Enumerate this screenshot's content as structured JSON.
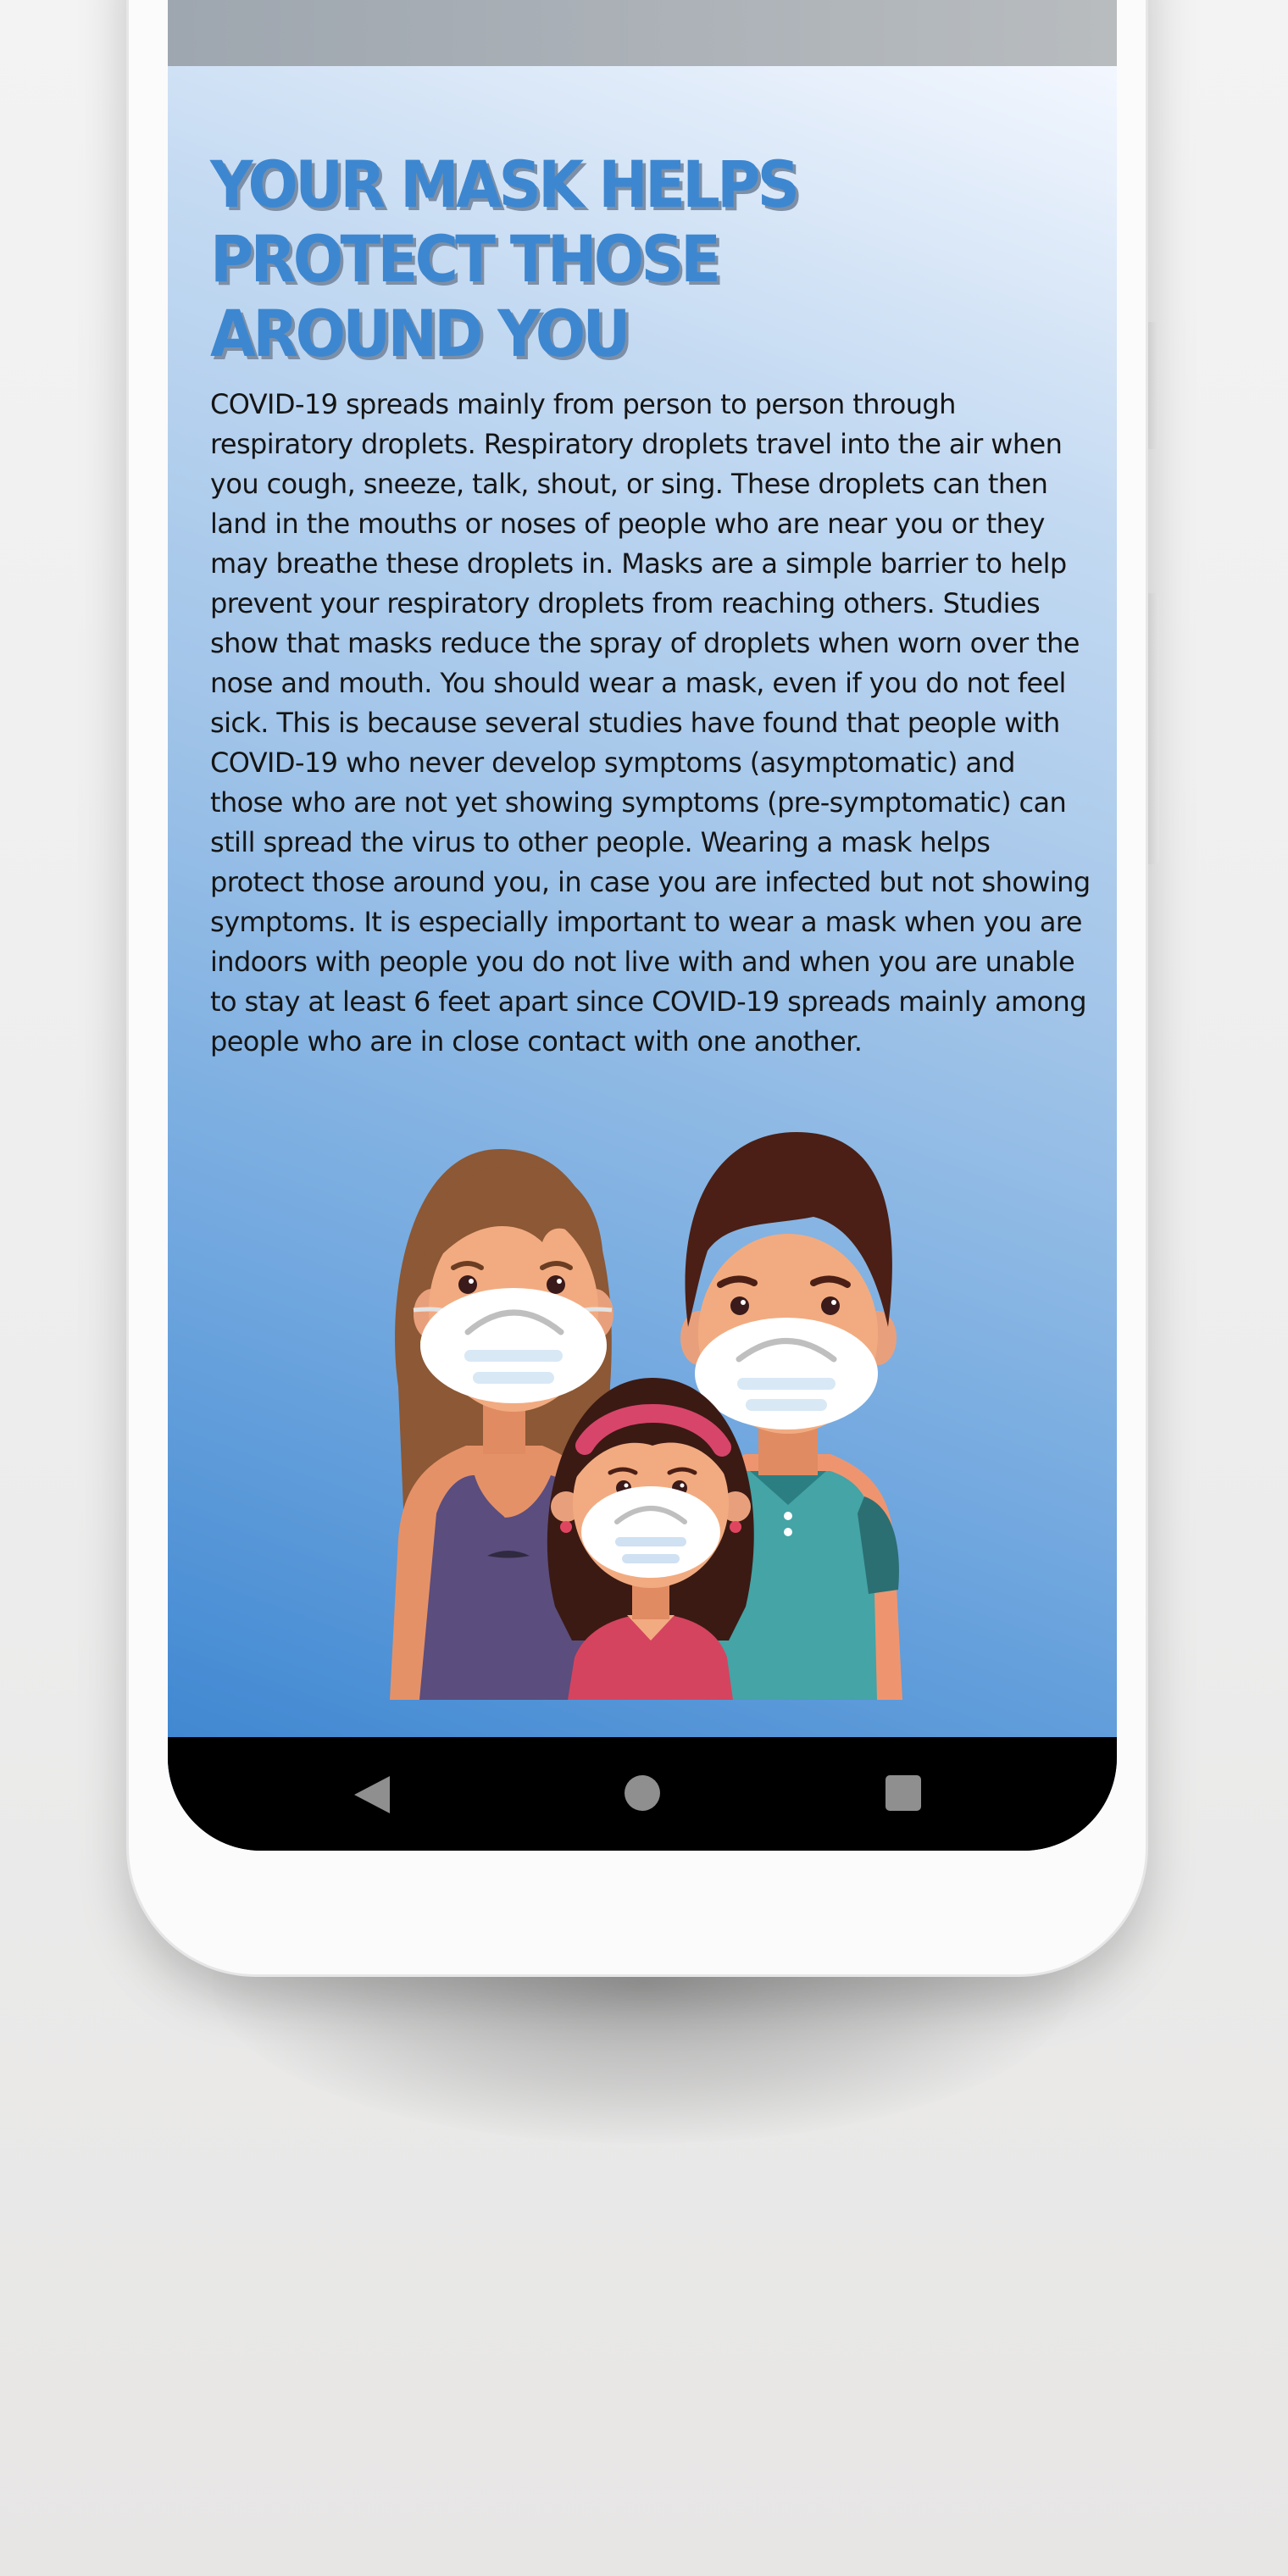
{
  "article": {
    "title": "YOUR MASK HELPS PROTECT THOSE AROUND YOU",
    "body": "COVID-19 spreads mainly from person to person through respiratory droplets. Respiratory droplets travel into the air when you cough, sneeze, talk, shout, or sing. These droplets can then land in the mouths or noses of people who are near you or they may breathe these droplets in. Masks are a simple barrier to help prevent your respiratory droplets from reaching others. Studies show that masks reduce the spray of droplets when worn over the nose and mouth. You should wear a mask, even if you do not feel sick. This is because several studies have found that people with COVID-19 who never develop symptoms (asymptomatic) and those who are not yet showing symptoms (pre-symptomatic) can still spread the virus to other people. Wearing a mask helps protect those around you, in case you are infected but not showing symptoms. It is especially important to wear a mask when you are indoors with people you do not live with and when you are unable to stay at least 6 feet apart since COVID-19 spreads mainly among people who are in close contact with one another."
  },
  "navigation": {
    "back_icon": "back-triangle-icon",
    "home_icon": "home-circle-icon",
    "recents_icon": "recents-square-icon"
  },
  "colors": {
    "title": "#3d87d1",
    "title_shadow": "#7c8fa6",
    "gradient_top": "#f3f7fe",
    "gradient_bottom": "#3a84d0",
    "nav_icon": "#8f8f8f"
  }
}
